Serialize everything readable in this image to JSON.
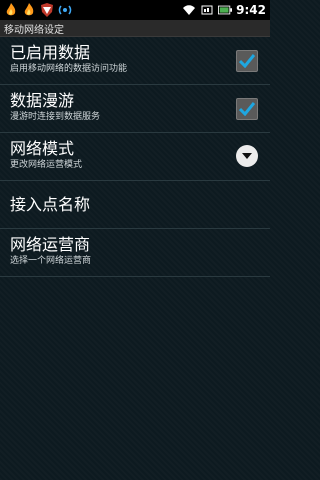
{
  "status_bar": {
    "time": "9:42",
    "icons": [
      "flame-icon",
      "flame-icon",
      "shield-icon",
      "wifi-broadcast-icon",
      "wifi-icon",
      "sim-icon",
      "battery-icon"
    ]
  },
  "title": "移动网络设定",
  "settings": [
    {
      "title": "已启用数据",
      "summary": "启用移动网络的数据访问功能",
      "control": "checkbox",
      "checked": true
    },
    {
      "title": "数据漫游",
      "summary": "漫游时连接到数据服务",
      "control": "checkbox",
      "checked": true
    },
    {
      "title": "网络模式",
      "summary": "更改网络运营模式",
      "control": "dropdown"
    },
    {
      "title": "接入点名称"
    },
    {
      "title": "网络运营商",
      "summary": "选择一个网络运营商"
    }
  ]
}
